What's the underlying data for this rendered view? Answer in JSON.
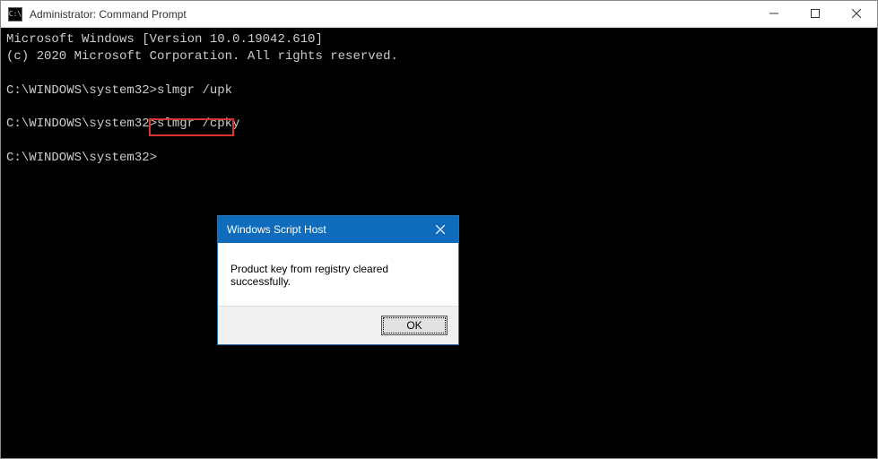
{
  "window": {
    "title": "Administrator: Command Prompt",
    "icon_glyph": "C:\\"
  },
  "console": {
    "line1": "Microsoft Windows [Version 10.0.19042.610]",
    "line2": "(c) 2020 Microsoft Corporation. All rights reserved.",
    "blank": "",
    "prompt1": "C:\\WINDOWS\\system32>",
    "cmd1": "slmgr /upk",
    "prompt2": "C:\\WINDOWS\\system32>",
    "cmd2": "slmgr /cpky",
    "prompt3": "C:\\WINDOWS\\system32>"
  },
  "dialog": {
    "title": "Windows Script Host",
    "message": "Product key from registry cleared successfully.",
    "ok_label": "OK"
  }
}
